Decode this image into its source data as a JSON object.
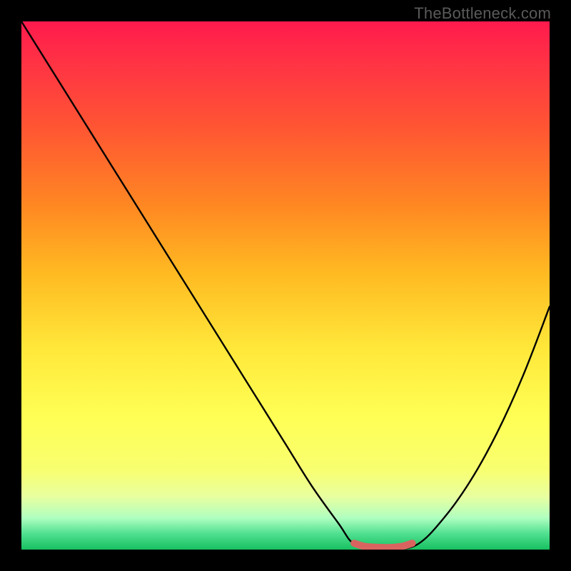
{
  "watermark": "TheBottleneck.com",
  "chart_data": {
    "type": "line",
    "title": "",
    "xlabel": "",
    "ylabel": "",
    "xlim": [
      0,
      100
    ],
    "ylim": [
      0,
      100
    ],
    "series": [
      {
        "name": "bottleneck-curve",
        "x": [
          0,
          5,
          10,
          15,
          20,
          25,
          30,
          35,
          40,
          45,
          50,
          55,
          60,
          63,
          67,
          70,
          75,
          80,
          85,
          90,
          95,
          100
        ],
        "values": [
          100,
          92,
          84,
          76,
          68,
          60,
          52,
          44,
          36,
          28,
          20,
          12,
          5,
          1,
          0,
          0,
          1,
          6,
          13,
          22,
          33,
          46
        ]
      },
      {
        "name": "optimal-range-marker",
        "x": [
          63,
          65,
          68,
          70,
          72,
          74
        ],
        "values": [
          1.2,
          0.6,
          0.4,
          0.4,
          0.6,
          1.2
        ]
      }
    ],
    "gradient_stops": [
      {
        "pos": 0,
        "color": "#ff1a4d"
      },
      {
        "pos": 20,
        "color": "#ff5533"
      },
      {
        "pos": 48,
        "color": "#ffbb22"
      },
      {
        "pos": 75,
        "color": "#ffff55"
      },
      {
        "pos": 94,
        "color": "#b0ffc0"
      },
      {
        "pos": 100,
        "color": "#18c060"
      }
    ]
  }
}
